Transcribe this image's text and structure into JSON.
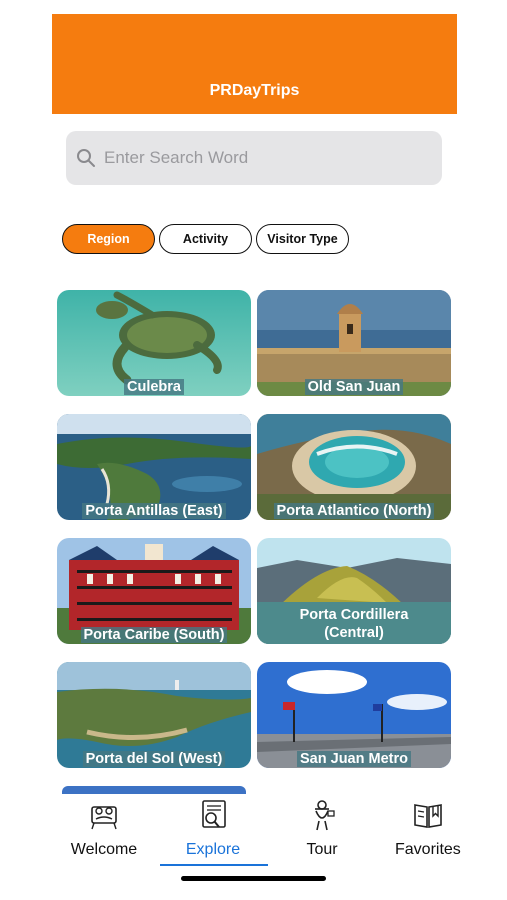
{
  "header": {
    "title": "PRDayTrips"
  },
  "search": {
    "placeholder": "Enter Search Word"
  },
  "filters": [
    {
      "label": "Region",
      "active": true
    },
    {
      "label": "Activity",
      "active": false
    },
    {
      "label": "Visitor Type",
      "active": false
    }
  ],
  "tiles": [
    {
      "label": "Culebra"
    },
    {
      "label": "Old San Juan"
    },
    {
      "label": "Porta Antillas (East)"
    },
    {
      "label": "Porta Atlantico (North)"
    },
    {
      "label": "Porta Caribe (South)"
    },
    {
      "label_line1": "Porta Cordillera",
      "label_line2": "(Central)"
    },
    {
      "label": "Porta del Sol (West)"
    },
    {
      "label": "San Juan Metro"
    }
  ],
  "tabs": [
    {
      "label": "Welcome",
      "icon": "welcome-icon"
    },
    {
      "label": "Explore",
      "icon": "explore-icon",
      "active": true
    },
    {
      "label": "Tour",
      "icon": "tour-icon"
    },
    {
      "label": "Favorites",
      "icon": "favorites-icon"
    }
  ],
  "colors": {
    "accent": "#f57c0f",
    "tab_active": "#1a73d9"
  }
}
